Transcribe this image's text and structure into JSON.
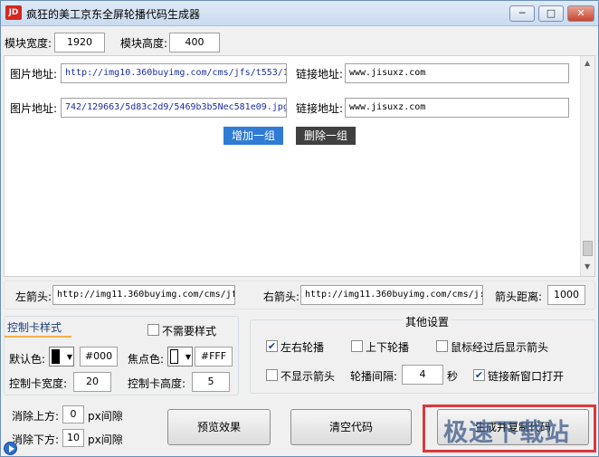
{
  "window": {
    "icon_text": "JD",
    "title": "疯狂的美工京东全屏轮播代码生成器"
  },
  "module": {
    "width_label": "模块宽度:",
    "width_value": "1920",
    "height_label": "模块高度:",
    "height_value": "400"
  },
  "groups": [
    {
      "image_label": "图片地址:",
      "image_value": "http://img10.360buyimg.com/cms/jfs/t553/1",
      "link_label": "链接地址:",
      "link_value": "www.jisuxz.com"
    },
    {
      "image_label": "图片地址:",
      "image_value": "742/129663/5d83c2d9/5469b3b5Nec581e09.jpg",
      "link_label": "链接地址:",
      "link_value": "www.jisuxz.com"
    }
  ],
  "group_buttons": {
    "add": "增加一组",
    "delete": "删除一组"
  },
  "arrows": {
    "left_label": "左箭头:",
    "left_value": "http://img11.360buyimg.com/cms/jf",
    "right_label": "右箭头:",
    "right_value": "http://img11.360buyimg.com/cms/j:",
    "distance_label": "箭头距离:",
    "distance_value": "1000"
  },
  "tab_style": {
    "title": "控制卡样式",
    "no_style_label": "不需要样式",
    "default_color_label": "默认色:",
    "default_color_value": "#000",
    "focus_color_label": "焦点色:",
    "focus_color_value": "#FFF",
    "tab_width_label": "控制卡宽度:",
    "tab_width_value": "20",
    "tab_height_label": "控制卡高度:",
    "tab_height_value": "5"
  },
  "other": {
    "title": "其他设置",
    "lr_carousel": "左右轮播",
    "ud_carousel": "上下轮播",
    "hover_arrow": "鼠标经过后显示箭头",
    "hide_arrow": "不显示箭头",
    "interval_label": "轮播间隔:",
    "interval_value": "4",
    "interval_unit": "秒",
    "new_window": "链接新窗口打开"
  },
  "gaps": {
    "top_label": "消除上方:",
    "top_value": "0",
    "top_unit": "px间隙",
    "bottom_label": "消除下方:",
    "bottom_value": "10",
    "bottom_unit": "px间隙"
  },
  "actions": {
    "preview": "预览效果",
    "clear": "清空代码",
    "generate": "生成并复制代码"
  },
  "watermark": "极速下载站",
  "colors": {
    "add_button": "#2f7bd6",
    "delete_button": "#404040"
  },
  "icons": {
    "minimize": "minimize-icon",
    "maximize": "maximize-icon",
    "close": "close-icon",
    "play": "play-icon"
  }
}
